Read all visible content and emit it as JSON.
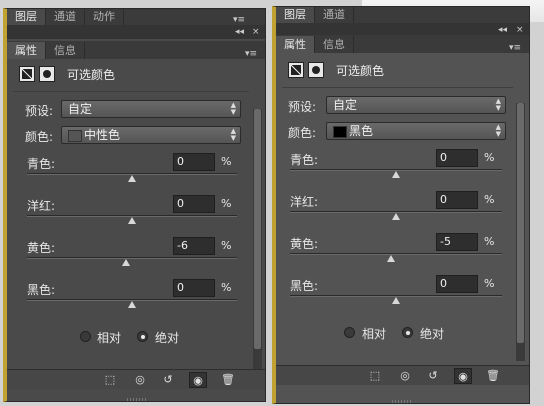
{
  "top_tabs": [
    "图层",
    "通道",
    "动作"
  ],
  "right_top_tabs": [
    "图层",
    "通道"
  ],
  "panel_tabs": [
    "属性",
    "信息"
  ],
  "adjustment_title": "可选颜色",
  "preset_label": "预设:",
  "preset_value": "自定",
  "color_label": "颜色:",
  "left": {
    "color_value": "中性色",
    "swatch": "#555555",
    "sliders": [
      {
        "label": "青色:",
        "value": "0",
        "pct": "%",
        "pos": 0.5
      },
      {
        "label": "洋红:",
        "value": "0",
        "pct": "%",
        "pos": 0.5
      },
      {
        "label": "黄色:",
        "value": "-6",
        "pct": "%",
        "pos": 0.47
      },
      {
        "label": "黑色:",
        "value": "0",
        "pct": "%",
        "pos": 0.5
      }
    ]
  },
  "right": {
    "color_value": "黑色",
    "swatch": "#000000",
    "sliders": [
      {
        "label": "青色:",
        "value": "0",
        "pct": "%",
        "pos": 0.5
      },
      {
        "label": "洋红:",
        "value": "0",
        "pct": "%",
        "pos": 0.5
      },
      {
        "label": "黄色:",
        "value": "-5",
        "pct": "%",
        "pos": 0.475
      },
      {
        "label": "黑色:",
        "value": "0",
        "pct": "%",
        "pos": 0.5
      }
    ]
  },
  "radio_relative": "相对",
  "radio_absolute": "绝对",
  "selected_method": "absolute",
  "collapse_glyph": "◂◂",
  "close_glyph": "×",
  "menu_glyph": "▾≡",
  "bottom_icons": [
    "clip-to-layer-icon",
    "view-previous-state-icon",
    "reset-icon",
    "visibility-eye-icon",
    "trash-icon"
  ]
}
